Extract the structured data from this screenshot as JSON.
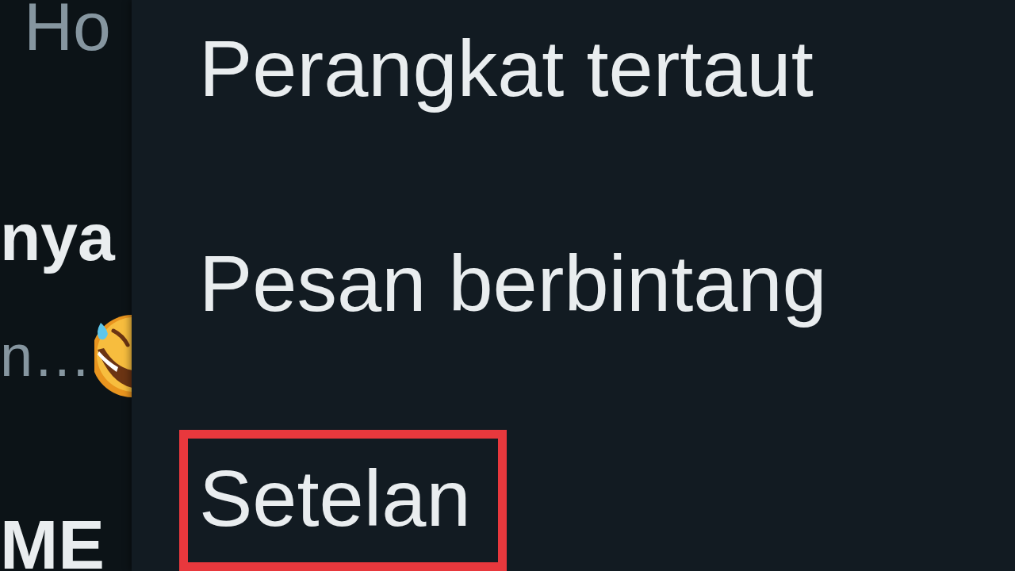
{
  "chat_list": {
    "rows": [
      {
        "preview": "Ho"
      },
      {
        "name": "nya",
        "preview": "n…",
        "has_emoji": true
      },
      {
        "name": "ME"
      }
    ]
  },
  "menu": {
    "items": [
      {
        "label": "Perangkat tertaut",
        "highlighted": false
      },
      {
        "label": "Pesan berbintang",
        "highlighted": false
      },
      {
        "label": "Setelan",
        "highlighted": true
      }
    ]
  }
}
